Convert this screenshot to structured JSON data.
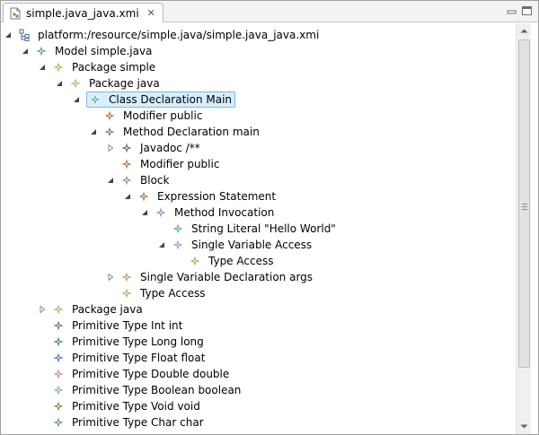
{
  "tab": {
    "title": "simple.java_java.xmi",
    "close_glyph": "✕"
  },
  "colors": {
    "selection_bg": "#d9eefc",
    "selection_border": "#7eb4ea"
  },
  "tree": [
    {
      "label": "platform:/resource/simple.java/simple.java_java.xmi",
      "depth": 0,
      "state": "expanded",
      "icon": "resource-icon",
      "color": "#6d8fb8"
    },
    {
      "label": "Model simple.java",
      "depth": 1,
      "state": "expanded",
      "icon": "model-icon",
      "color": "#6aa16a"
    },
    {
      "label": "Package simple",
      "depth": 2,
      "state": "expanded",
      "icon": "package-icon",
      "color": "#9cbf6a"
    },
    {
      "label": "Package java",
      "depth": 3,
      "state": "expanded",
      "icon": "package-icon",
      "color": "#b8b06a"
    },
    {
      "label": "Class Declaration Main",
      "depth": 4,
      "state": "expanded",
      "icon": "class-icon",
      "color": "#5fa9a8",
      "selected": true
    },
    {
      "label": "Modifier public",
      "depth": 5,
      "state": "leaf",
      "icon": "modifier-icon",
      "color": "#b07a4a"
    },
    {
      "label": "Method Declaration main",
      "depth": 5,
      "state": "expanded",
      "icon": "method-icon",
      "color": "#8a7a66"
    },
    {
      "label": "Javadoc /**",
      "depth": 6,
      "state": "collapsed",
      "icon": "javadoc-icon",
      "color": "#6b6b6b"
    },
    {
      "label": "Modifier public",
      "depth": 6,
      "state": "leaf",
      "icon": "modifier-icon",
      "color": "#b07a4a"
    },
    {
      "label": "Block",
      "depth": 6,
      "state": "expanded",
      "icon": "block-icon",
      "color": "#9a86c8"
    },
    {
      "label": "Expression Statement",
      "depth": 7,
      "state": "expanded",
      "icon": "expression-icon",
      "color": "#b0784a"
    },
    {
      "label": "Method Invocation",
      "depth": 8,
      "state": "expanded",
      "icon": "invocation-icon",
      "color": "#a888c4"
    },
    {
      "label": "String Literal \"Hello World\"",
      "depth": 9,
      "state": "leaf",
      "icon": "literal-icon",
      "color": "#5fa9a8"
    },
    {
      "label": "Single Variable Access",
      "depth": 9,
      "state": "expanded",
      "icon": "variable-icon",
      "color": "#8aa2c8"
    },
    {
      "label": "Type Access",
      "depth": 10,
      "state": "leaf",
      "icon": "type-access-icon",
      "color": "#a8b85a"
    },
    {
      "label": "Single Variable Declaration args",
      "depth": 6,
      "state": "collapsed",
      "icon": "declaration-icon",
      "color": "#c49a6a"
    },
    {
      "label": "Type Access",
      "depth": 6,
      "state": "leaf",
      "icon": "type-access-icon",
      "color": "#a8b85a"
    },
    {
      "label": "Package java",
      "depth": 2,
      "state": "collapsed",
      "icon": "package-icon",
      "color": "#9cbf6a"
    },
    {
      "label": "Primitive Type Int int",
      "depth": 2,
      "state": "leaf",
      "icon": "primitive-icon",
      "color": "#8a6a6a"
    },
    {
      "label": "Primitive Type Long long",
      "depth": 2,
      "state": "leaf",
      "icon": "primitive-icon",
      "color": "#4a8a6a"
    },
    {
      "label": "Primitive Type Float float",
      "depth": 2,
      "state": "leaf",
      "icon": "primitive-icon",
      "color": "#5a7ab8"
    },
    {
      "label": "Primitive Type Double double",
      "depth": 2,
      "state": "leaf",
      "icon": "primitive-icon",
      "color": "#c488b8"
    },
    {
      "label": "Primitive Type Boolean boolean",
      "depth": 2,
      "state": "leaf",
      "icon": "primitive-icon",
      "color": "#88b888"
    },
    {
      "label": "Primitive Type Void void",
      "depth": 2,
      "state": "leaf",
      "icon": "primitive-icon",
      "color": "#8a8a4a"
    },
    {
      "label": "Primitive Type Char char",
      "depth": 2,
      "state": "leaf",
      "icon": "primitive-icon",
      "color": "#6a8ab0"
    }
  ]
}
